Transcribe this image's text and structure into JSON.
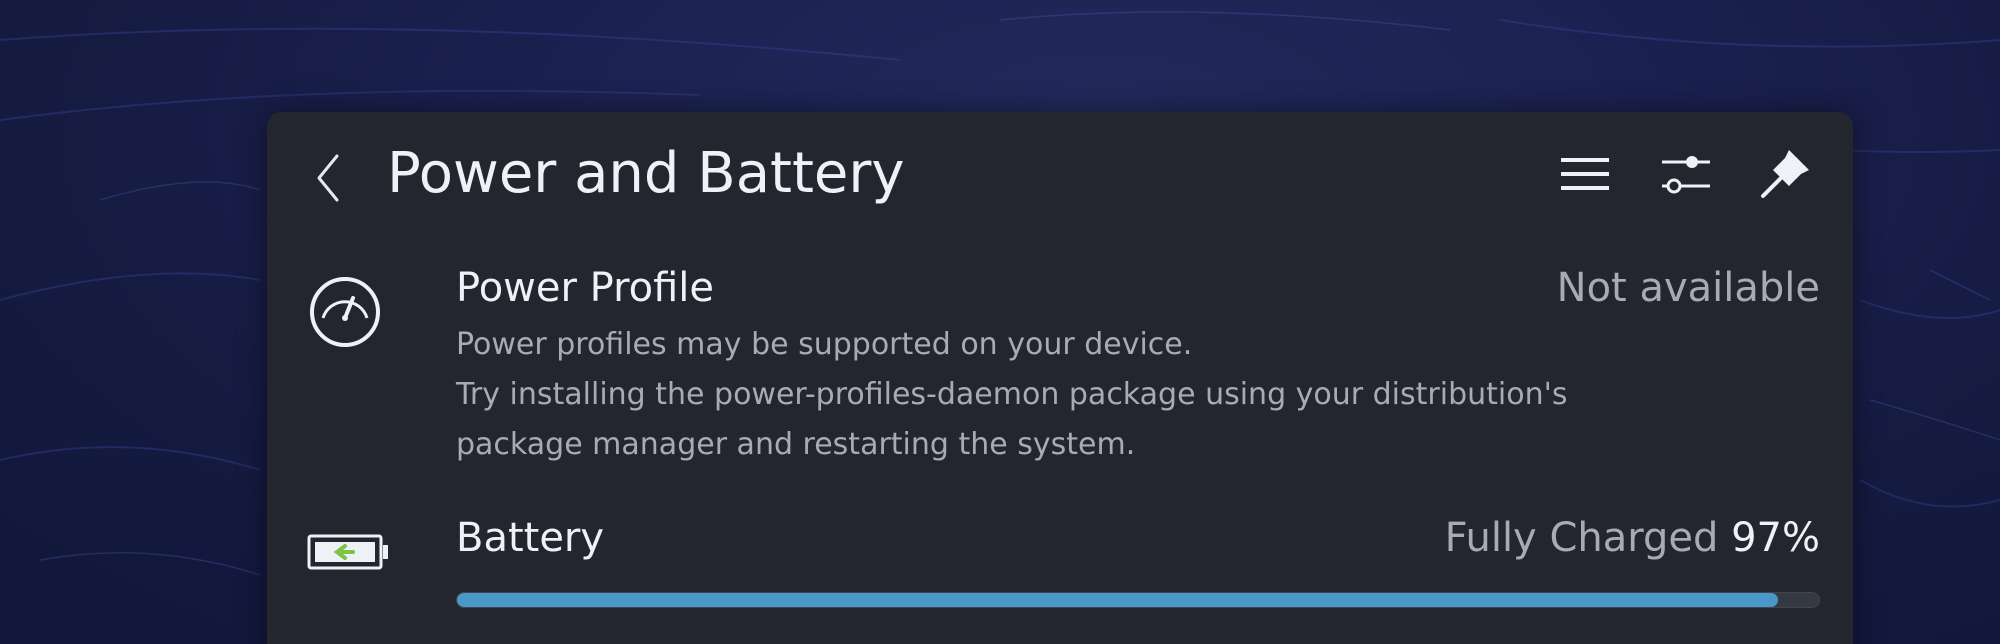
{
  "header": {
    "title": "Power and Battery",
    "icons": {
      "back": "chevron-left-icon",
      "menu": "hamburger-menu-icon",
      "configure": "sliders-icon",
      "pin": "pin-icon"
    }
  },
  "power_profile": {
    "icon": "gauge-icon",
    "title": "Power Profile",
    "status": "Not available",
    "description": [
      "Power profiles may be supported on your device.",
      "Try installing the power-profiles-daemon package using your distribution's",
      "package manager and restarting the system."
    ]
  },
  "battery": {
    "icon": "battery-charging-icon",
    "title": "Battery",
    "status": "Fully Charged",
    "percent": "97%",
    "level": 0.97
  },
  "colors": {
    "panel": "#23262f",
    "accent": "#4a98c9",
    "battery_plug": "#7ec348"
  }
}
